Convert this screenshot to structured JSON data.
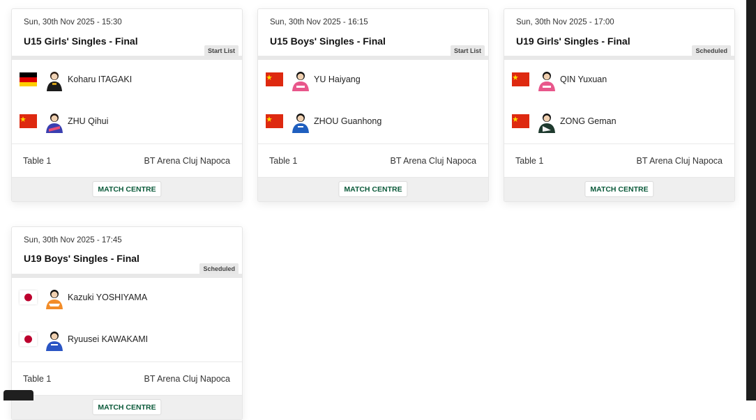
{
  "cards": [
    {
      "date": "Sun, 30th Nov 2025 - 15:30",
      "title": "U15 Girls' Singles - Final",
      "badge": "Start List",
      "players": [
        {
          "name": "Koharu ITAGAKI",
          "flag": "germany-flag"
        },
        {
          "name": "ZHU Qihui",
          "flag": "china-flag"
        }
      ],
      "table": "Table 1",
      "venue": "BT Arena Cluj Napoca",
      "button": "MATCH CENTRE"
    },
    {
      "date": "Sun, 30th Nov 2025 - 16:15",
      "title": "U15 Boys' Singles - Final",
      "badge": "Start List",
      "players": [
        {
          "name": "YU Haiyang",
          "flag": "china-flag"
        },
        {
          "name": "ZHOU Guanhong",
          "flag": "china-flag"
        }
      ],
      "table": "Table 1",
      "venue": "BT Arena Cluj Napoca",
      "button": "MATCH CENTRE"
    },
    {
      "date": "Sun, 30th Nov 2025 - 17:00",
      "title": "U19 Girls' Singles - Final",
      "badge": "Scheduled",
      "players": [
        {
          "name": "QIN Yuxuan",
          "flag": "china-flag"
        },
        {
          "name": "ZONG Geman",
          "flag": "china-flag"
        }
      ],
      "table": "Table 1",
      "venue": "BT Arena Cluj Napoca",
      "button": "MATCH CENTRE"
    },
    {
      "date": "Sun, 30th Nov 2025 - 17:45",
      "title": "U19 Boys' Singles - Final",
      "badge": "Scheduled",
      "players": [
        {
          "name": "Kazuki YOSHIYAMA",
          "flag": "japan-flag"
        },
        {
          "name": "Ryuusei KAWAKAMI",
          "flag": "japan-flag"
        }
      ],
      "table": "Table 1",
      "venue": "BT Arena Cluj Napoca",
      "button": "MATCH CENTRE"
    }
  ],
  "colors": {
    "accent": "#0b5a3a",
    "china": "#de2910",
    "japan": "#bc002d",
    "germany_black": "#000000",
    "germany_red": "#dd0000",
    "germany_gold": "#ffce00"
  }
}
